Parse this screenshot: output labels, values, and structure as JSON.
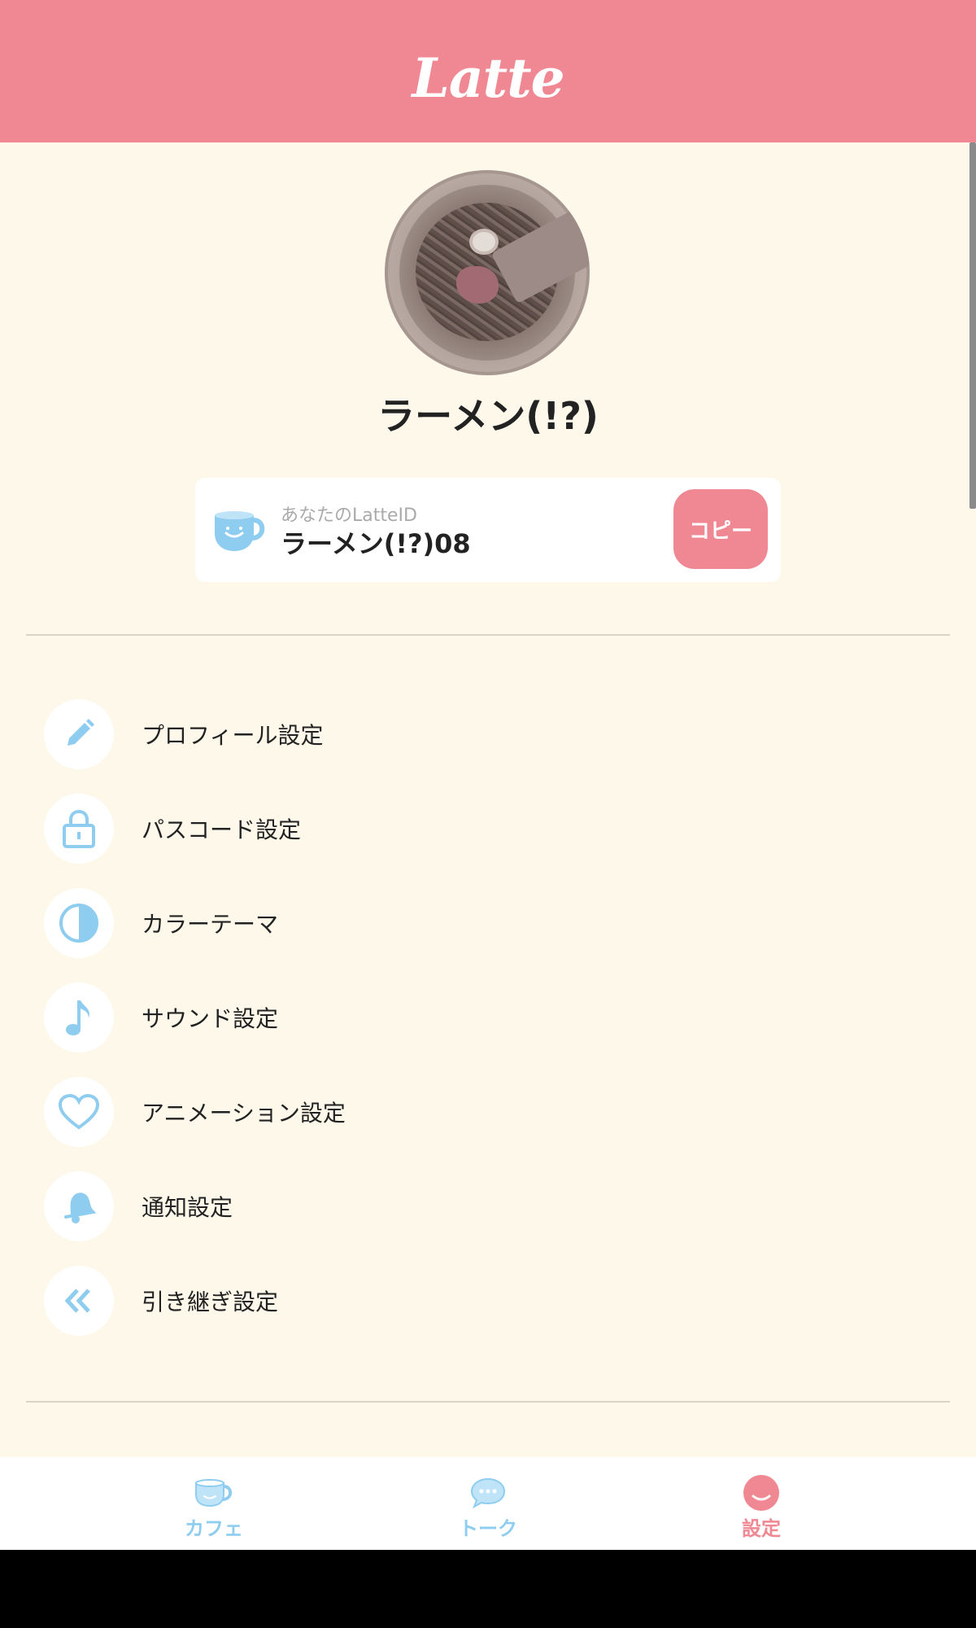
{
  "header": {
    "logo": "Latte"
  },
  "profile": {
    "username": "ラーメン(!?)",
    "id_caption": "あなたのLatteID",
    "id_value": "ラーメン(!?)08",
    "copy_label": "コピー"
  },
  "menu": [
    {
      "label": "プロフィール設定",
      "icon": "pencil-icon"
    },
    {
      "label": "パスコード設定",
      "icon": "lock-icon"
    },
    {
      "label": "カラーテーマ",
      "icon": "half-circle-icon"
    },
    {
      "label": "サウンド設定",
      "icon": "music-note-icon"
    },
    {
      "label": "アニメーション設定",
      "icon": "heart-icon"
    },
    {
      "label": "通知設定",
      "icon": "bell-icon"
    },
    {
      "label": "引き継ぎ設定",
      "icon": "double-chevron-left-icon"
    }
  ],
  "tabbar": {
    "tabs": [
      {
        "label": "カフェ",
        "icon": "cup-icon",
        "active": false
      },
      {
        "label": "トーク",
        "icon": "speech-bubble-icon",
        "active": false
      },
      {
        "label": "設定",
        "icon": "smiley-icon",
        "active": true
      }
    ]
  },
  "colors": {
    "accent_pink": "#f08893",
    "icon_blue": "#8ecdf0",
    "background_cream": "#fdf8ea"
  }
}
